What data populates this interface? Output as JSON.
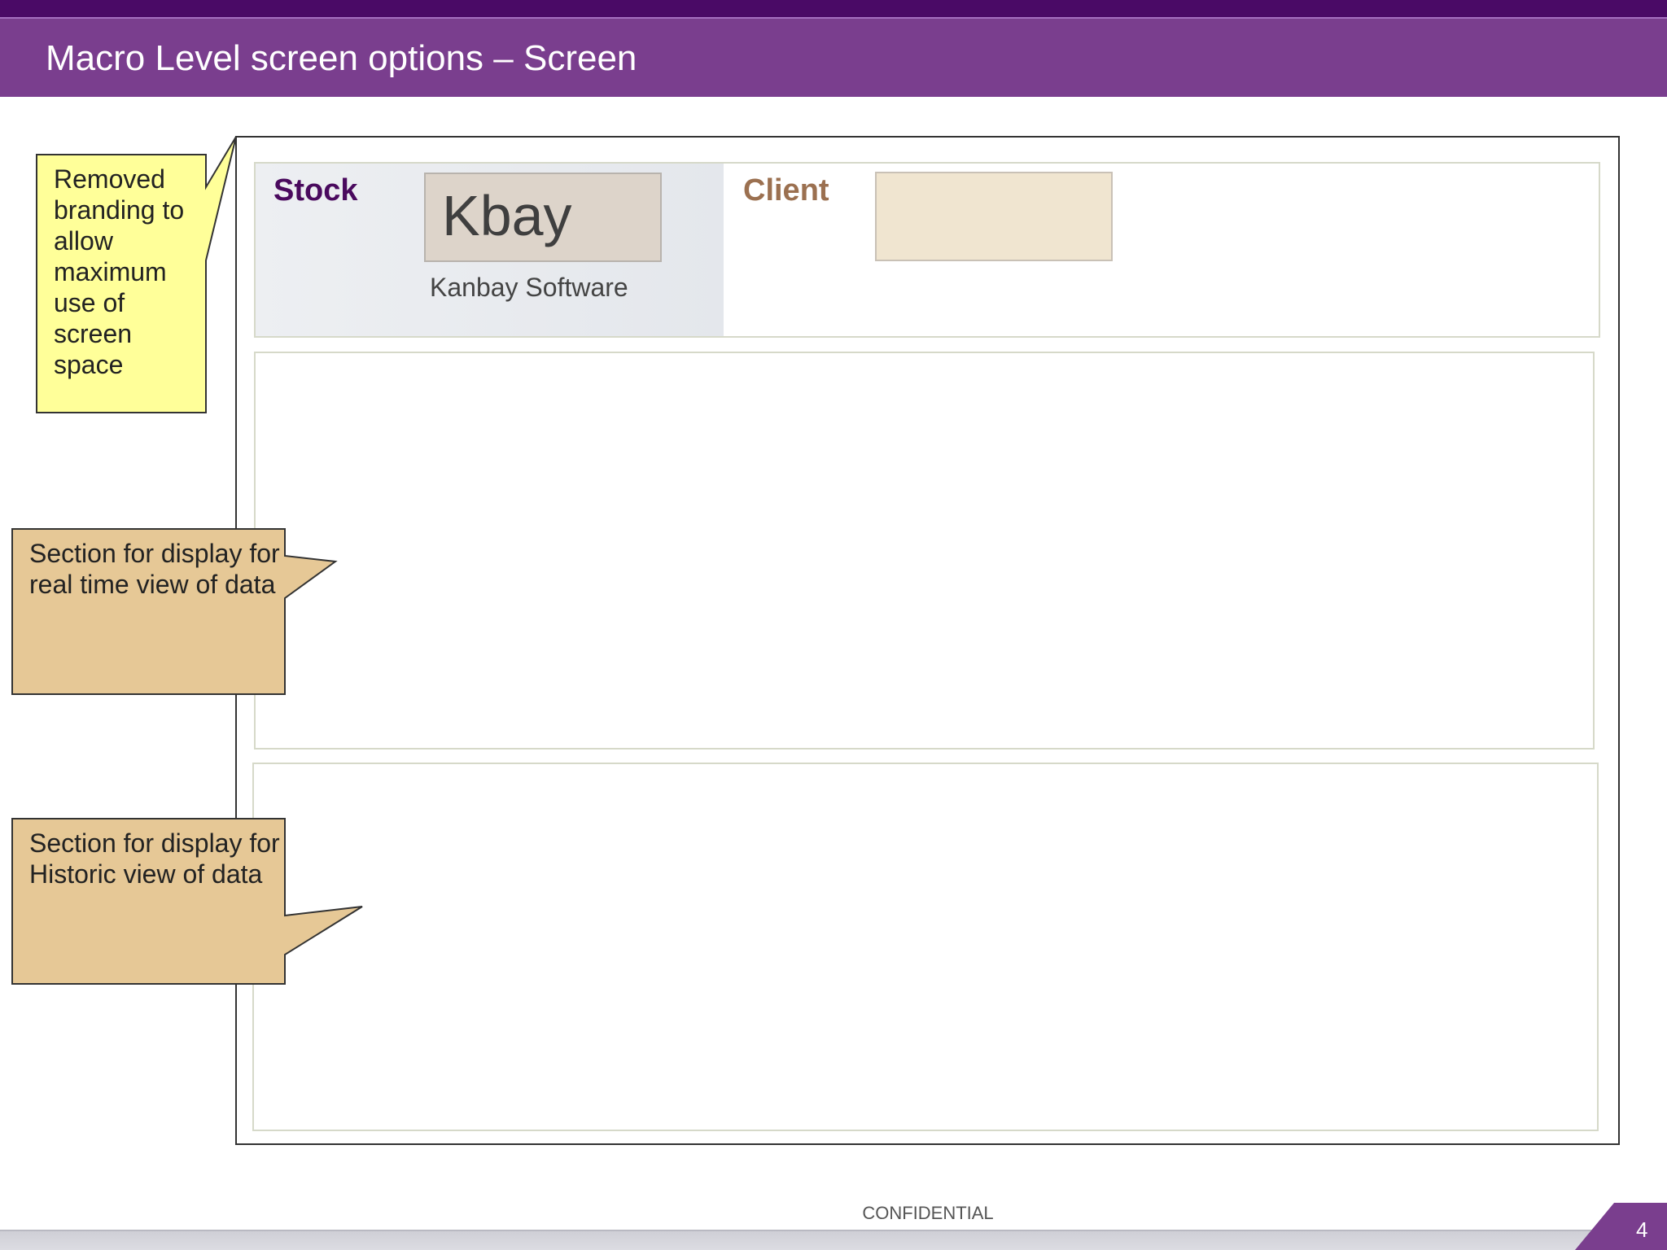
{
  "slide": {
    "title": "Macro Level screen options – Screen",
    "footer": "CONFIDENTIAL",
    "page_number": "4"
  },
  "mockup": {
    "stock_label": "Stock",
    "logo_text": "Kbay",
    "company_name": "Kanbay Software",
    "client_label": "Client"
  },
  "callouts": {
    "branding": "Removed branding to allow maximum use of screen space",
    "realtime": "Section for display for real time view of data",
    "historic": "Section for display for Historic view of data"
  },
  "colors": {
    "title_bar": "#7a3e8e",
    "top_bar": "#4a0a66",
    "stock_label": "#4a0a5e",
    "client_label": "#9b7050",
    "note_yellow": "#ffff99",
    "note_tan": "#e6c896"
  }
}
